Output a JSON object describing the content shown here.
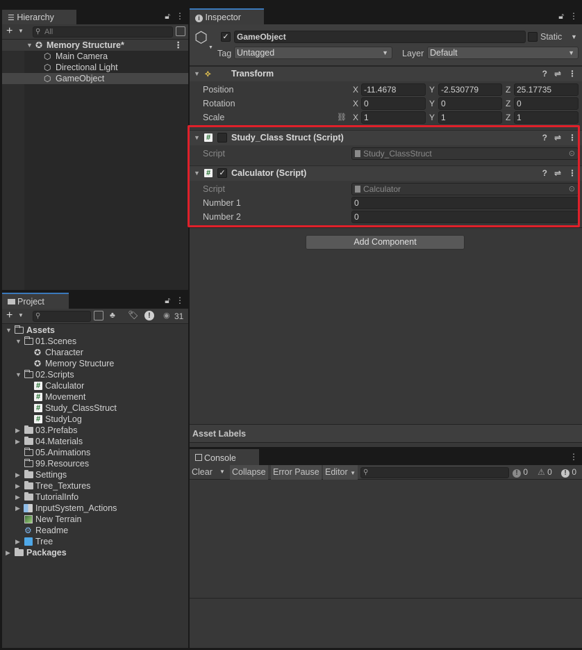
{
  "hierarchy": {
    "tab": "Hierarchy",
    "search_placeholder": "All",
    "scene": "Memory Structure*",
    "objects": [
      "Main Camera",
      "Directional Light",
      "GameObject"
    ]
  },
  "inspector": {
    "tab": "Inspector",
    "object_name": "GameObject",
    "static_label": "Static",
    "tag_label": "Tag",
    "tag_value": "Untagged",
    "layer_label": "Layer",
    "layer_value": "Default",
    "transform": {
      "title": "Transform",
      "position": {
        "label": "Position",
        "x": "-11.4678",
        "y": "-2.530779",
        "z": "25.17735"
      },
      "rotation": {
        "label": "Rotation",
        "x": "0",
        "y": "0",
        "z": "0"
      },
      "scale": {
        "label": "Scale",
        "x": "1",
        "y": "1",
        "z": "1"
      },
      "axis_x": "X",
      "axis_y": "Y",
      "axis_z": "Z"
    },
    "study_component": {
      "title": "Study_Class Struct (Script)",
      "script_label": "Script",
      "script_value": "Study_ClassStruct",
      "enabled": false
    },
    "calculator_component": {
      "title": "Calculator (Script)",
      "script_label": "Script",
      "script_value": "Calculator",
      "number1_label": "Number 1",
      "number1_value": "0",
      "number2_label": "Number 2",
      "number2_value": "0",
      "enabled": true
    },
    "add_component": "Add Component",
    "asset_labels": "Asset Labels",
    "highlight_color": "#e0202a"
  },
  "project": {
    "tab": "Project",
    "hidden_count": "31",
    "tree": {
      "assets": "Assets",
      "scenes": "01.Scenes",
      "scene_items": [
        "Character",
        "Memory Structure"
      ],
      "scripts": "02.Scripts",
      "script_items": [
        "Calculator",
        "Movement",
        "Study_ClassStruct",
        "StudyLog"
      ],
      "folders": [
        "03.Prefabs",
        "04.Materials",
        "05.Animations",
        "99.Resources",
        "Settings",
        "Tree_Textures",
        "TutorialInfo"
      ],
      "input_actions": "InputSystem_Actions",
      "terrain": "New Terrain",
      "readme": "Readme",
      "tree_prefab": "Tree",
      "packages": "Packages"
    }
  },
  "console": {
    "tab": "Console",
    "clear": "Clear",
    "collapse": "Collapse",
    "error_pause": "Error Pause",
    "editor": "Editor",
    "log_count": "0",
    "warning_count": "0",
    "error_count": "0"
  }
}
